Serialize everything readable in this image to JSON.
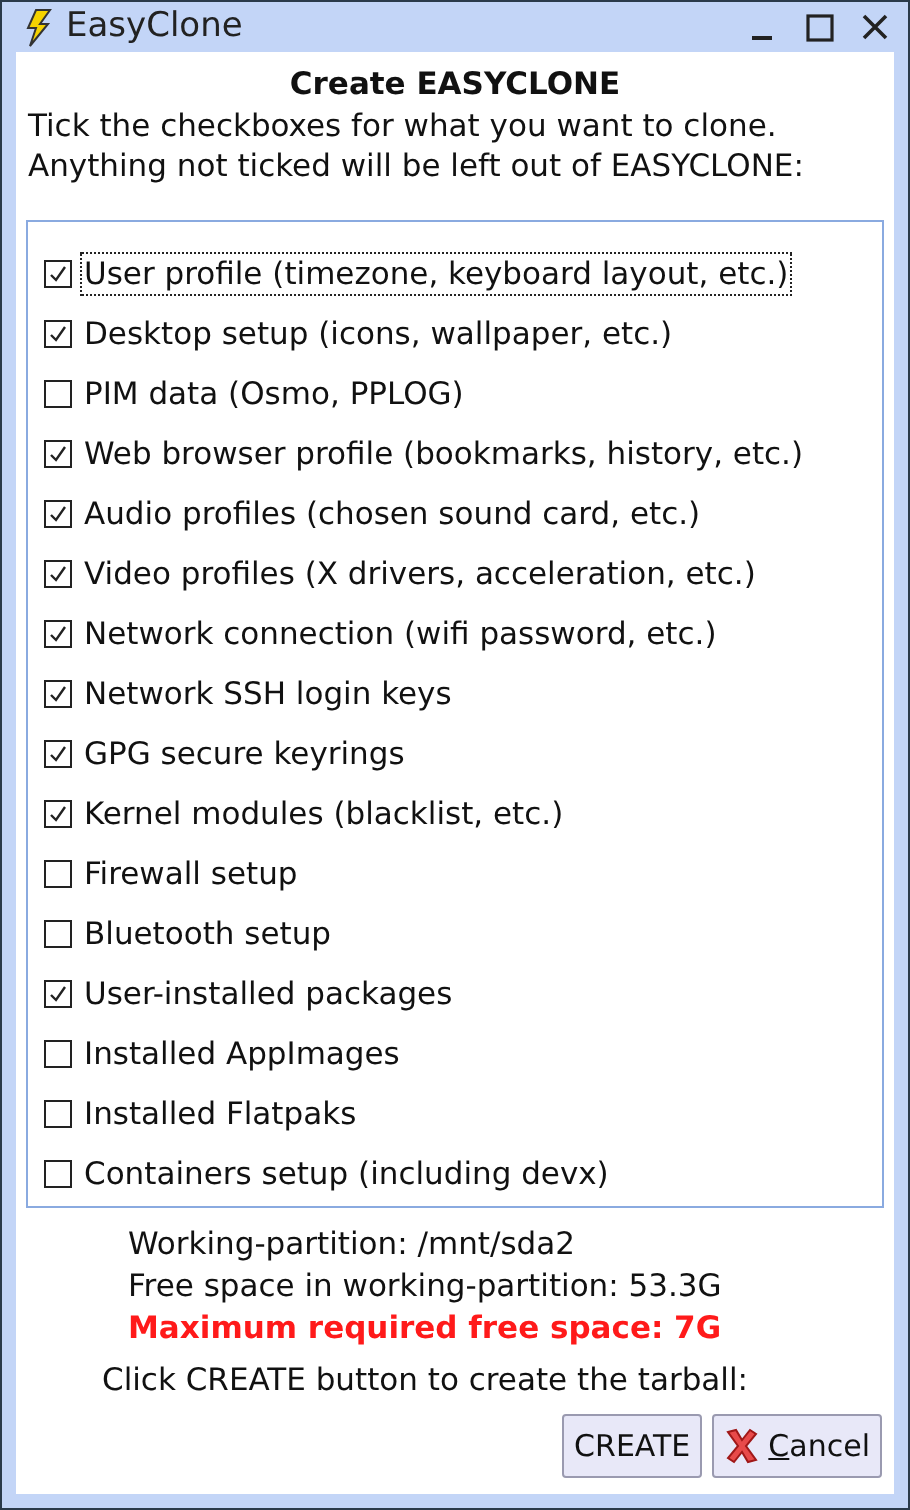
{
  "window": {
    "title": "EasyClone"
  },
  "heading": "Create EASYCLONE",
  "intro": [
    "Tick the checkboxes for what you want to clone.",
    "Anything not ticked will be left out of EASYCLONE:"
  ],
  "options": [
    {
      "label": "User profile (timezone, keyboard layout, etc.)",
      "checked": true,
      "focused": true
    },
    {
      "label": "Desktop setup (icons, wallpaper, etc.)",
      "checked": true,
      "focused": false
    },
    {
      "label": "PIM data (Osmo, PPLOG)",
      "checked": false,
      "focused": false
    },
    {
      "label": "Web browser profile (bookmarks, history, etc.)",
      "checked": true,
      "focused": false
    },
    {
      "label": "Audio profiles (chosen sound card, etc.)",
      "checked": true,
      "focused": false
    },
    {
      "label": "Video profiles (X drivers, acceleration, etc.)",
      "checked": true,
      "focused": false
    },
    {
      "label": "Network connection (wifi password, etc.)",
      "checked": true,
      "focused": false
    },
    {
      "label": "Network SSH login keys",
      "checked": true,
      "focused": false
    },
    {
      "label": "GPG secure keyrings",
      "checked": true,
      "focused": false
    },
    {
      "label": "Kernel modules (blacklist, etc.)",
      "checked": true,
      "focused": false
    },
    {
      "label": "Firewall setup",
      "checked": false,
      "focused": false
    },
    {
      "label": "Bluetooth setup",
      "checked": false,
      "focused": false
    },
    {
      "label": "User-installed packages",
      "checked": true,
      "focused": false
    },
    {
      "label": "Installed AppImages",
      "checked": false,
      "focused": false
    },
    {
      "label": "Installed Flatpaks",
      "checked": false,
      "focused": false
    },
    {
      "label": "Containers setup (including devx)",
      "checked": false,
      "focused": false
    }
  ],
  "info": [
    {
      "text": "Working-partition: /mnt/sda2",
      "kind": "normal"
    },
    {
      "text": "Free space in working-partition: 53.3G",
      "kind": "normal"
    },
    {
      "text": "Maximum required free space: 7G",
      "kind": "warning"
    }
  ],
  "prompt": "Click CREATE button to create the tarball:",
  "buttons": [
    {
      "label": "CREATE",
      "kind": "plain",
      "mnemonic_first": false
    },
    {
      "label": "Cancel",
      "kind": "cancel",
      "mnemonic_first": true
    }
  ]
}
